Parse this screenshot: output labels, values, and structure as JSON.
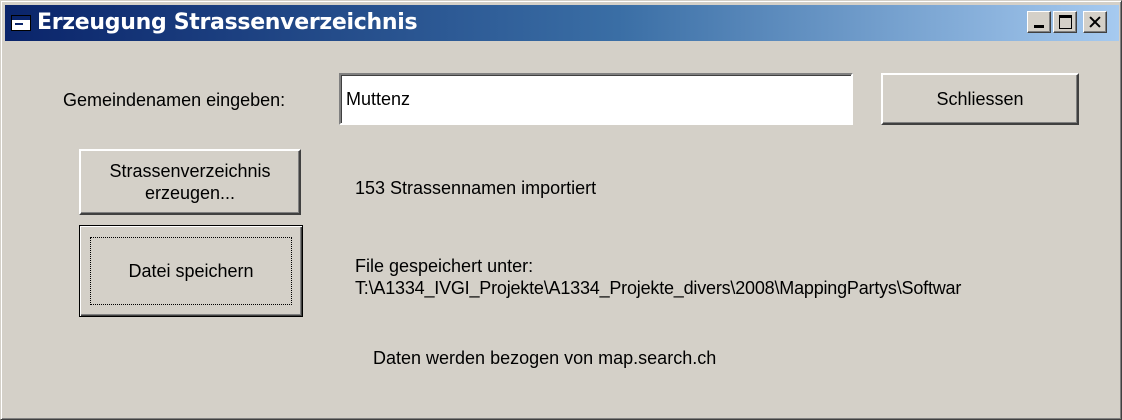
{
  "window": {
    "title": "Erzeugung Strassenverzeichnis",
    "icon": "form-icon",
    "controls": [
      "minimize-icon",
      "maximize-icon",
      "close-icon"
    ]
  },
  "form": {
    "gemeinde_label": "Gemeindenamen eingeben:",
    "gemeinde_value": "Muttenz",
    "close_button": "Schliessen",
    "generate_button_line1": "Strassenverzeichnis",
    "generate_button_line2": "erzeugen...",
    "import_status": "153 Strassennamen importiert",
    "save_button": "Datei speichern",
    "saved_label": "File gespeichert unter:",
    "saved_path": "T:\\A1334_IVGI_Projekte\\A1334_Projekte_divers\\2008\\MappingPartys\\Softwar",
    "source_note": "Daten werden bezogen von map.search.ch"
  },
  "colors": {
    "face": "#d4d0c8",
    "title_start": "#0a246a",
    "title_end": "#a6caf0"
  }
}
